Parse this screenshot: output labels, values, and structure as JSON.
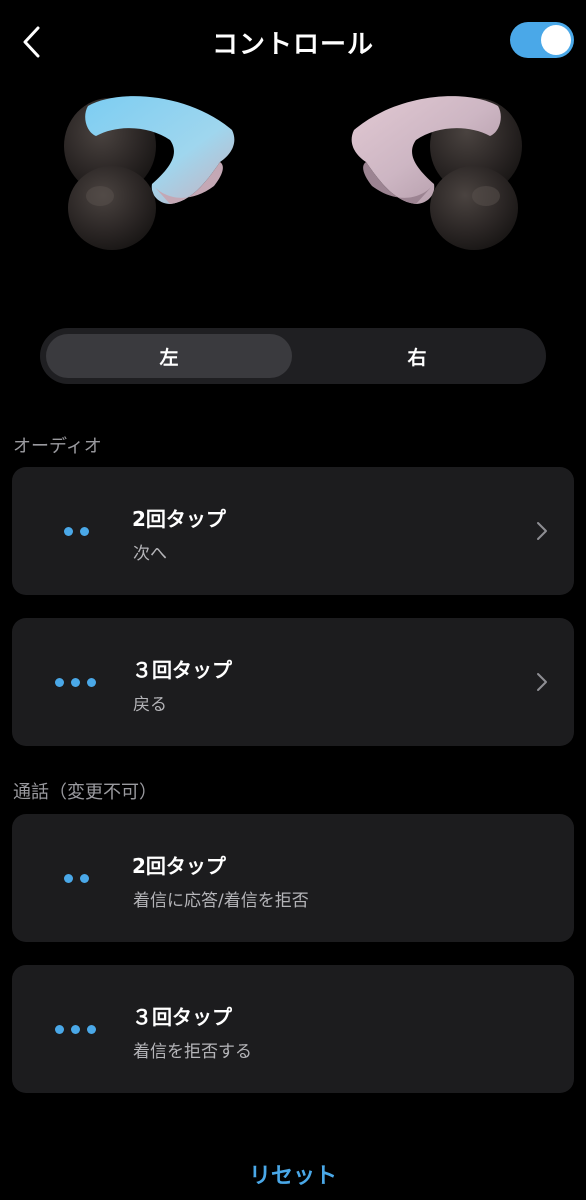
{
  "header": {
    "title": "コントロール",
    "back_icon": "chevron-left-icon",
    "toggle_on": true
  },
  "colors": {
    "accent": "#4aa8e8",
    "card_bg": "#1c1c1e",
    "background": "#000000"
  },
  "segmented": {
    "left_label": "左",
    "right_label": "右",
    "selected": "左"
  },
  "sections": {
    "audio": {
      "label": "オーディオ",
      "items": [
        {
          "dots_icon": "two-dots-icon",
          "title": "2回タップ",
          "subtitle": "次へ",
          "has_chevron": true
        },
        {
          "dots_icon": "three-dots-icon",
          "title": "３回タップ",
          "subtitle": "戻る",
          "has_chevron": true
        }
      ]
    },
    "call": {
      "label": "通話（変更不可）",
      "items": [
        {
          "dots_icon": "two-dots-icon",
          "title": "2回タップ",
          "subtitle": "着信に応答/着信を拒否",
          "has_chevron": false
        },
        {
          "dots_icon": "three-dots-icon",
          "title": "３回タップ",
          "subtitle": "着信を拒否する",
          "has_chevron": false
        }
      ]
    }
  },
  "footer": {
    "reset_label": "リセット"
  }
}
